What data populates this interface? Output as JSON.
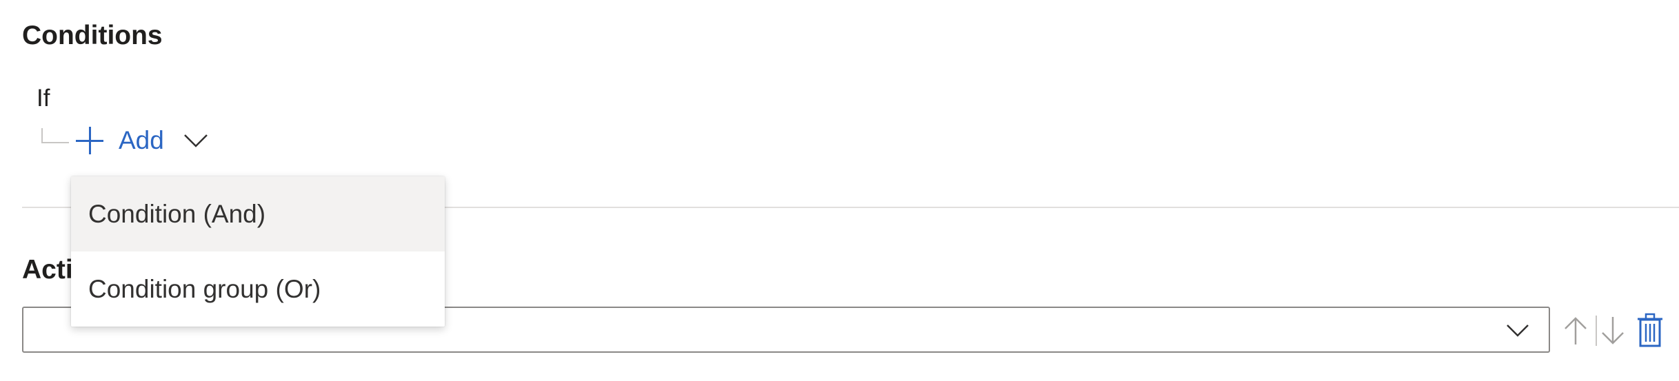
{
  "conditions": {
    "title": "Conditions",
    "if_label": "If",
    "add_label": "Add",
    "menu": {
      "items": [
        {
          "label": "Condition (And)",
          "highlighted": true
        },
        {
          "label": "Condition group (Or)",
          "highlighted": false
        }
      ]
    }
  },
  "actions": {
    "title": "Actions",
    "select_value": ""
  },
  "icons": {
    "add": "plus-icon",
    "add_dropdown": "chevron-down-icon",
    "select_dropdown": "chevron-down-icon",
    "move_up": "arrow-up-icon",
    "move_down": "arrow-down-icon",
    "delete": "trash-icon"
  },
  "colors": {
    "accent": "#2b66c3",
    "text": "#201f1e",
    "menu_hover": "#f3f2f1",
    "border": "#8a8886",
    "disabled_icon": "#a19f9d"
  }
}
